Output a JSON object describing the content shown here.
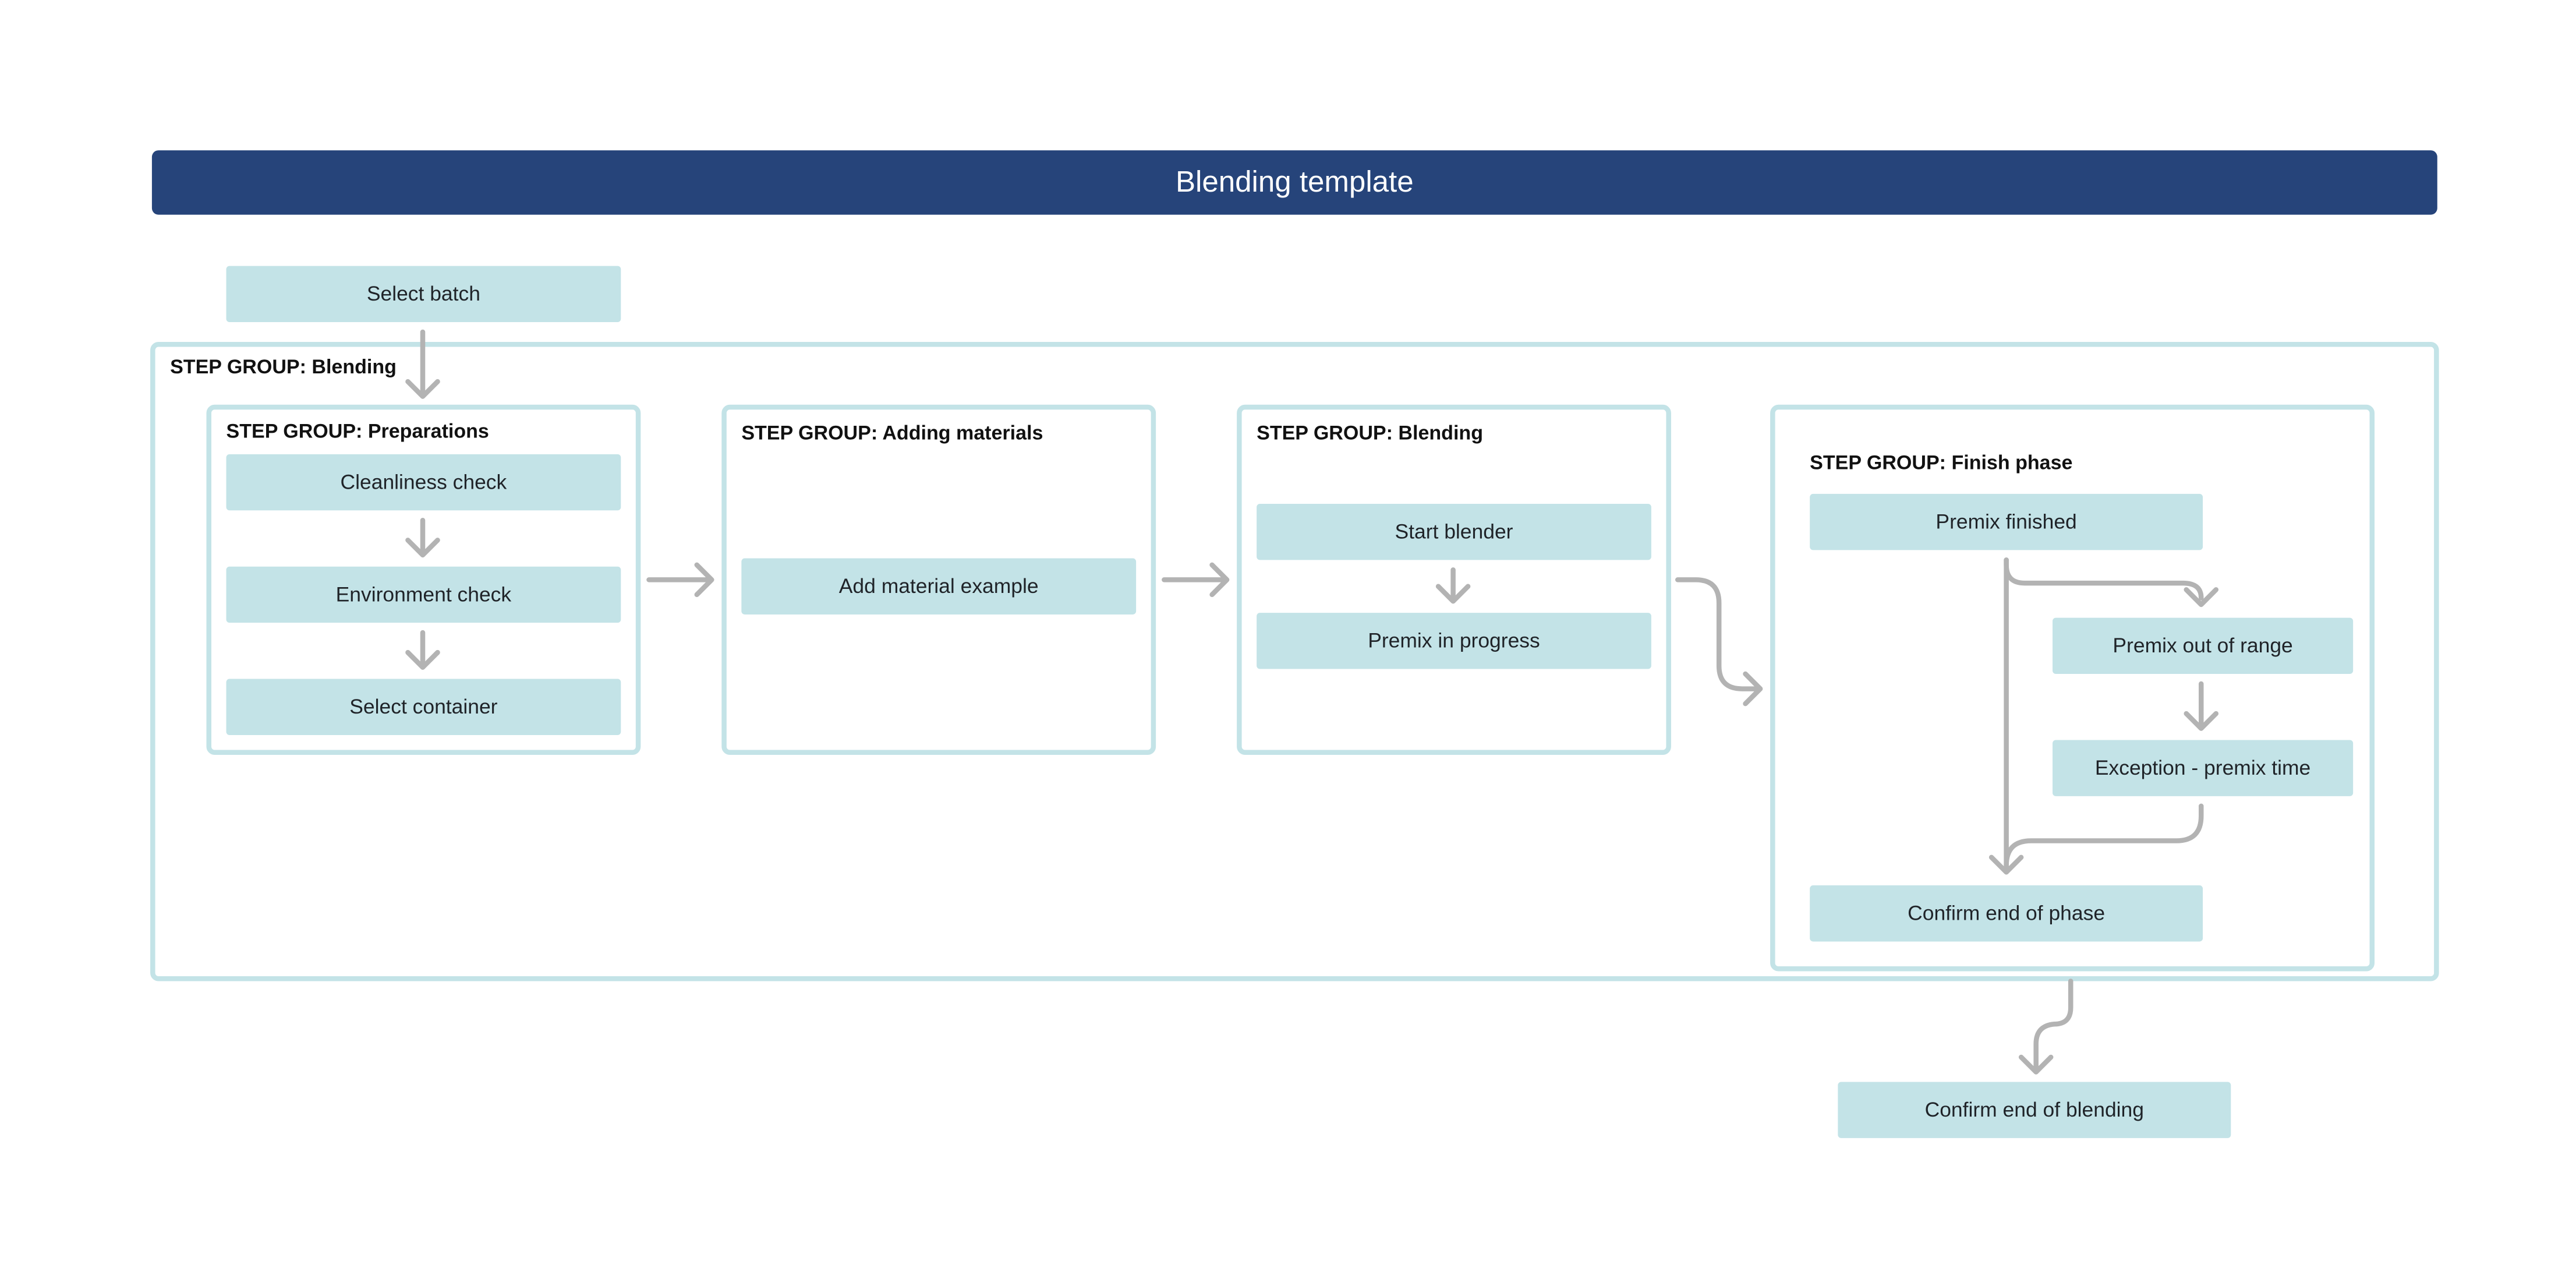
{
  "header": {
    "title": "Blending template"
  },
  "colors": {
    "header_bg": "#26447a",
    "step_bg": "#c3e3e7",
    "group_border": "#c3e3e7",
    "connector": "#b3b3b3"
  },
  "start_step": {
    "label": "Select batch"
  },
  "outer_group": {
    "label": "STEP GROUP: Blending",
    "groups": [
      {
        "label": "STEP GROUP: Preparations",
        "steps": [
          "Cleanliness check",
          "Environment check",
          "Select container"
        ]
      },
      {
        "label": "STEP GROUP: Adding materials",
        "steps": [
          "Add material example"
        ]
      },
      {
        "label": "STEP GROUP: Blending",
        "steps": [
          "Start blender",
          "Premix in progress"
        ]
      },
      {
        "label": "STEP GROUP: Finish phase",
        "steps": [
          "Premix finished",
          "Premix out of range",
          "Exception - premix time",
          "Confirm end of phase"
        ]
      }
    ]
  },
  "end_step": {
    "label": "Confirm end of blending"
  }
}
